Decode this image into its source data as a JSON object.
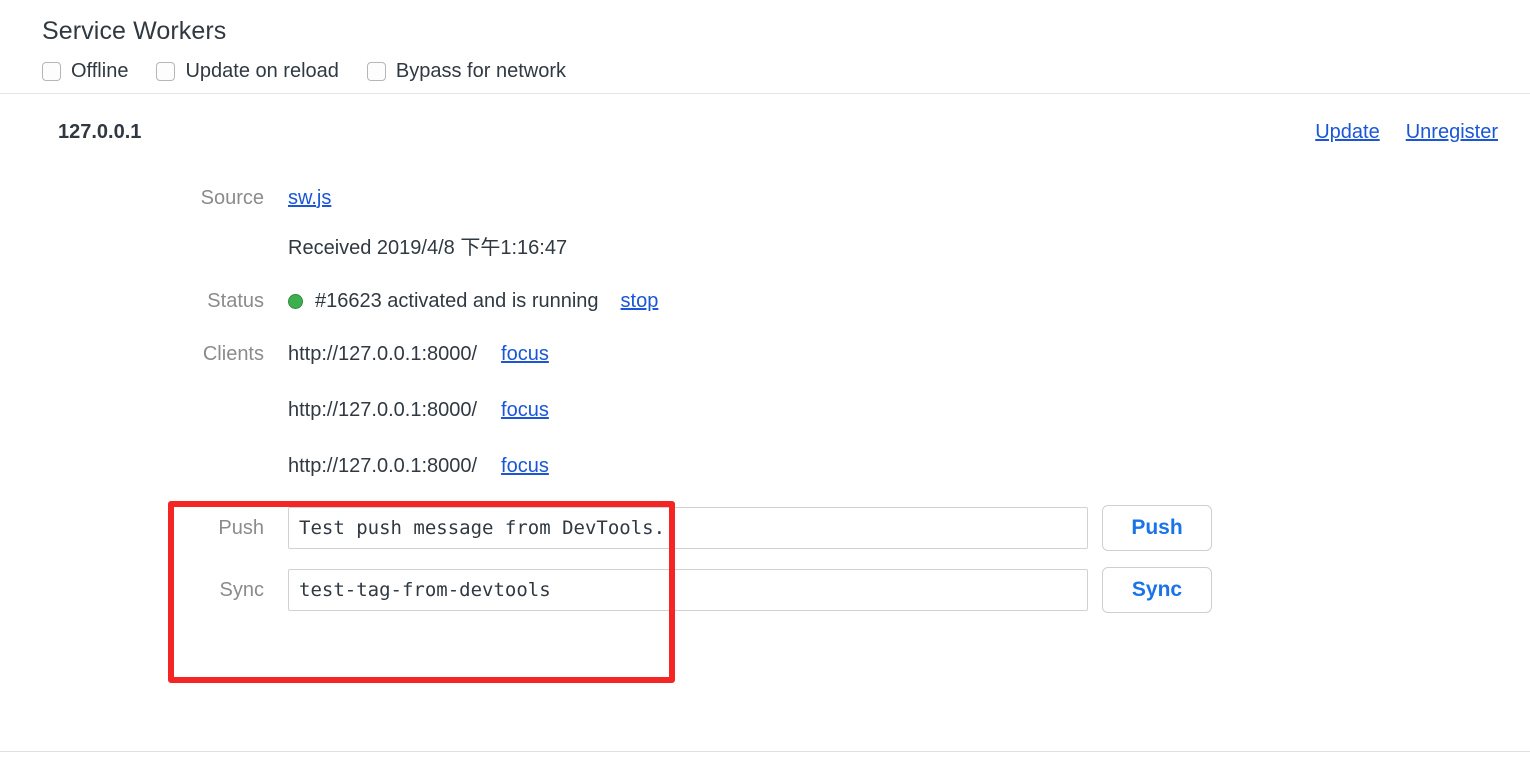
{
  "panel": {
    "title": "Service Workers",
    "options": [
      {
        "label": "Offline",
        "checked": false
      },
      {
        "label": "Update on reload",
        "checked": false
      },
      {
        "label": "Bypass for network",
        "checked": false
      }
    ]
  },
  "registration": {
    "origin": "127.0.0.1",
    "actions": {
      "update": "Update",
      "unregister": "Unregister"
    },
    "source": {
      "label": "Source",
      "file": "sw.js",
      "received": "Received 2019/4/8 下午1:16:47"
    },
    "status": {
      "label": "Status",
      "indicator_color": "#3eaf4e",
      "text": "#16623 activated and is running",
      "stop_link": "stop"
    },
    "clients": {
      "label": "Clients",
      "highlight_color": "#f32525",
      "items": [
        {
          "url": "http://127.0.0.1:8000/",
          "focus_link": "focus"
        },
        {
          "url": "http://127.0.0.1:8000/",
          "focus_link": "focus"
        },
        {
          "url": "http://127.0.0.1:8000/",
          "focus_link": "focus"
        }
      ]
    },
    "push": {
      "label": "Push",
      "value": "Test push message from DevTools.",
      "button": "Push"
    },
    "sync": {
      "label": "Sync",
      "value": "test-tag-from-devtools",
      "button": "Sync"
    }
  },
  "colors": {
    "link": "#1a56d6",
    "button_text": "#1a73e8",
    "label": "#8b8b8b"
  }
}
